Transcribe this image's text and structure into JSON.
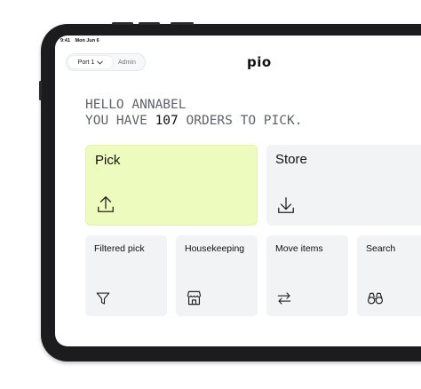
{
  "status_bar": {
    "time": "9:41",
    "date": "Mon Jun 6"
  },
  "header": {
    "port_label": "Port 1",
    "admin_label": "Admin",
    "logo_text": "pio"
  },
  "greeting": {
    "line1": "HELLO ANNABEL",
    "line2_prefix": "YOU HAVE ",
    "order_count": "107",
    "line2_suffix": " ORDERS TO PICK."
  },
  "primary_actions": [
    {
      "label": "Pick",
      "icon": "upload-icon",
      "color": "#eefbbf"
    },
    {
      "label": "Store",
      "icon": "download-icon",
      "color": "#f1f3f5"
    }
  ],
  "secondary_actions": [
    {
      "label": "Filtered pick",
      "icon": "filter-icon"
    },
    {
      "label": "Housekeeping",
      "icon": "storefront-icon"
    },
    {
      "label": "Move items",
      "icon": "swap-arrows-icon"
    },
    {
      "label": "Search",
      "icon": "binoculars-icon"
    }
  ],
  "colors": {
    "device_frame": "#1c1c1e",
    "pick_accent": "#eefbbf",
    "card_bg": "#f1f3f5",
    "greeting_text": "#5f6368"
  }
}
